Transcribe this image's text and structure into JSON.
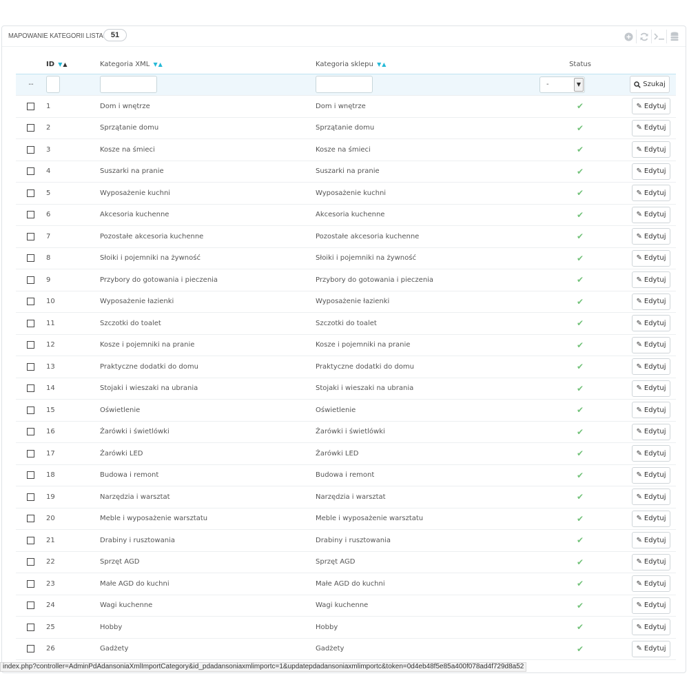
{
  "panel": {
    "title": "Mapowanie kategorii Lista",
    "count": "51",
    "toolbar_icons": [
      "add-icon",
      "refresh-icon",
      "sql-query-icon",
      "export-icon"
    ]
  },
  "table": {
    "columns": {
      "id": "ID",
      "xml_category": "Kategoria XML",
      "shop_category": "Kategoria sklepu",
      "status": "Status"
    },
    "filter": {
      "bulk_placeholder": "--",
      "status_value": "-",
      "search_label": "Szukaj"
    },
    "edit_label": "Edytuj",
    "status_icon": "check-icon",
    "status_color": "#72c279",
    "rows": [
      {
        "id": "1",
        "xml": "Dom i wnętrze",
        "shop": "Dom i wnętrze",
        "enabled": true
      },
      {
        "id": "2",
        "xml": "Sprzątanie domu",
        "shop": "Sprzątanie domu",
        "enabled": true
      },
      {
        "id": "3",
        "xml": "Kosze na śmieci",
        "shop": "Kosze na śmieci",
        "enabled": true
      },
      {
        "id": "4",
        "xml": "Suszarki na pranie",
        "shop": "Suszarki na pranie",
        "enabled": true
      },
      {
        "id": "5",
        "xml": "Wyposażenie kuchni",
        "shop": "Wyposażenie kuchni",
        "enabled": true
      },
      {
        "id": "6",
        "xml": "Akcesoria kuchenne",
        "shop": "Akcesoria kuchenne",
        "enabled": true
      },
      {
        "id": "7",
        "xml": "Pozostałe akcesoria kuchenne",
        "shop": "Pozostałe akcesoria kuchenne",
        "enabled": true
      },
      {
        "id": "8",
        "xml": "Słoiki i pojemniki na żywność",
        "shop": "Słoiki i pojemniki na żywność",
        "enabled": true
      },
      {
        "id": "9",
        "xml": "Przybory do gotowania i pieczenia",
        "shop": "Przybory do gotowania i pieczenia",
        "enabled": true
      },
      {
        "id": "10",
        "xml": "Wyposażenie łazienki",
        "shop": "Wyposażenie łazienki",
        "enabled": true
      },
      {
        "id": "11",
        "xml": "Szczotki do toalet",
        "shop": "Szczotki do toalet",
        "enabled": true
      },
      {
        "id": "12",
        "xml": "Kosze i pojemniki na pranie",
        "shop": "Kosze i pojemniki na pranie",
        "enabled": true
      },
      {
        "id": "13",
        "xml": "Praktyczne dodatki do domu",
        "shop": "Praktyczne dodatki do domu",
        "enabled": true
      },
      {
        "id": "14",
        "xml": "Stojaki i wieszaki na ubrania",
        "shop": "Stojaki i wieszaki na ubrania",
        "enabled": true
      },
      {
        "id": "15",
        "xml": "Oświetlenie",
        "shop": "Oświetlenie",
        "enabled": true
      },
      {
        "id": "16",
        "xml": "Żarówki i świetlówki",
        "shop": "Żarówki i świetlówki",
        "enabled": true
      },
      {
        "id": "17",
        "xml": "Żarówki LED",
        "shop": "Żarówki LED",
        "enabled": true
      },
      {
        "id": "18",
        "xml": "Budowa i remont",
        "shop": "Budowa i remont",
        "enabled": true
      },
      {
        "id": "19",
        "xml": "Narzędzia i warsztat",
        "shop": "Narzędzia i warsztat",
        "enabled": true
      },
      {
        "id": "20",
        "xml": "Meble i wyposażenie warsztatu",
        "shop": "Meble i wyposażenie warsztatu",
        "enabled": true
      },
      {
        "id": "21",
        "xml": "Drabiny i rusztowania",
        "shop": "Drabiny i rusztowania",
        "enabled": true
      },
      {
        "id": "22",
        "xml": "Sprzęt AGD",
        "shop": "Sprzęt AGD",
        "enabled": true
      },
      {
        "id": "23",
        "xml": "Małe AGD do kuchni",
        "shop": "Małe AGD do kuchni",
        "enabled": true
      },
      {
        "id": "24",
        "xml": "Wagi kuchenne",
        "shop": "Wagi kuchenne",
        "enabled": true
      },
      {
        "id": "25",
        "xml": "Hobby",
        "shop": "Hobby",
        "enabled": true
      },
      {
        "id": "26",
        "xml": "Gadżety",
        "shop": "Gadżety",
        "enabled": true
      }
    ]
  },
  "status_bar": {
    "url": "index.php?controller=AdminPdAdansoniaXmlImportCategory&id_pdadansoniaxmlimportc=1&updatepdadansoniaxmlimportc&token=0d4eb48f5e85a400f078ad4f729d8a52"
  }
}
